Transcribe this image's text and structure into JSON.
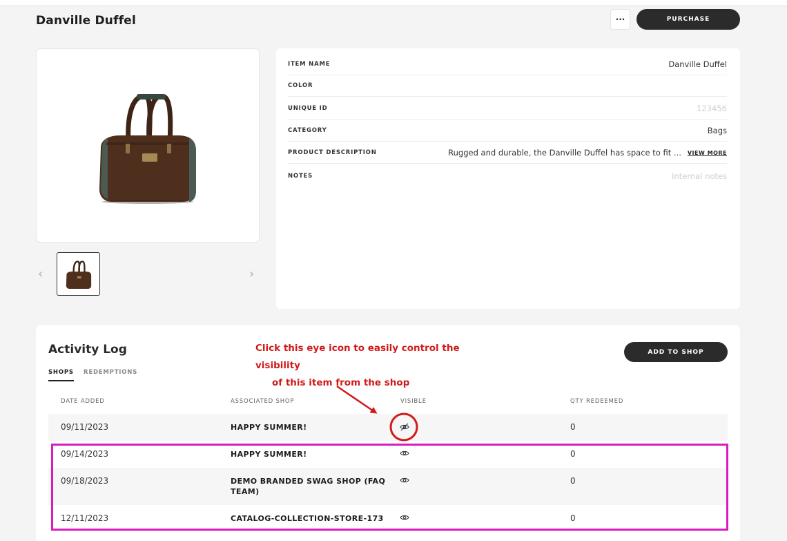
{
  "page": {
    "title": "Danville Duffel",
    "more_label": "···",
    "purchase_label": "PURCHASE"
  },
  "details": [
    {
      "label": "ITEM NAME",
      "value": "Danville Duffel",
      "placeholder": false
    },
    {
      "label": "COLOR",
      "value": "",
      "placeholder": false
    },
    {
      "label": "UNIQUE ID",
      "value": "123456",
      "placeholder": true
    },
    {
      "label": "CATEGORY",
      "value": "Bags",
      "placeholder": false
    },
    {
      "label": "PRODUCT DESCRIPTION",
      "value": "Rugged and durable, the Danville Duffel has space to fit ...",
      "placeholder": false
    },
    {
      "label": "NOTES",
      "value": "Internal notes",
      "placeholder": true
    }
  ],
  "view_more_label": "VIEW MORE",
  "carousel": {
    "prev": "‹",
    "next": "›"
  },
  "activity": {
    "title": "Activity Log",
    "tabs": [
      "SHOPS",
      "REDEMPTIONS"
    ],
    "add_to_shop_label": "ADD TO SHOP",
    "columns": [
      "DATE ADDED",
      "ASSOCIATED SHOP",
      "VISIBLE",
      "QTY REDEEMED"
    ],
    "rows": [
      {
        "date": "09/11/2023",
        "shop": "HAPPY SUMMER!",
        "visible": false,
        "qty": "0"
      },
      {
        "date": "09/14/2023",
        "shop": "HAPPY SUMMER!",
        "visible": true,
        "qty": "0"
      },
      {
        "date": "09/18/2023",
        "shop": "DEMO BRANDED SWAG SHOP (FAQ TEAM)",
        "visible": true,
        "qty": "0"
      },
      {
        "date": "12/11/2023",
        "shop": "CATALOG-COLLECTION-STORE-173",
        "visible": true,
        "qty": "0"
      }
    ]
  },
  "annotation": {
    "line1": "Click this eye icon to easily control the visibility",
    "line2": "of this item from the shop",
    "color": "#d11a1a",
    "highlight_color": "#d81bbd"
  }
}
